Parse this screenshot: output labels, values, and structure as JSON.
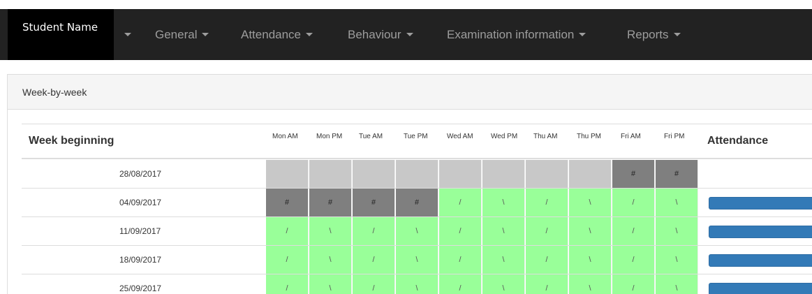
{
  "navbar": {
    "brand": "Student Name",
    "items": [
      {
        "label": ""
      },
      {
        "label": "General"
      },
      {
        "label": "Attendance"
      },
      {
        "label": "Behaviour"
      },
      {
        "label": "Examination information"
      },
      {
        "label": "Reports"
      }
    ]
  },
  "panel": {
    "title": "Week-by-week"
  },
  "table": {
    "header_week": "Week beginning",
    "header_attendance": "Attendance",
    "sessions": [
      "Mon AM",
      "Mon PM",
      "Tue AM",
      "Tue PM",
      "Wed AM",
      "Wed PM",
      "Thu AM",
      "Thu PM",
      "Fri AM",
      "Fri PM"
    ],
    "rows": [
      {
        "date": "28/08/2017",
        "marks": [
          "",
          "",
          "",
          "",
          "",
          "",
          "",
          "",
          "#",
          "#"
        ],
        "status": [
          "na",
          "na",
          "na",
          "na",
          "na",
          "na",
          "na",
          "na",
          "dk",
          "dk"
        ],
        "bar": false
      },
      {
        "date": "04/09/2017",
        "marks": [
          "#",
          "#",
          "#",
          "#",
          "/",
          "\\",
          "/",
          "\\",
          "/",
          "\\"
        ],
        "status": [
          "dk",
          "dk",
          "dk",
          "dk",
          "pr",
          "pr",
          "pr",
          "pr",
          "pr",
          "pr"
        ],
        "bar": true
      },
      {
        "date": "11/09/2017",
        "marks": [
          "/",
          "\\",
          "/",
          "\\",
          "/",
          "\\",
          "/",
          "\\",
          "/",
          "\\"
        ],
        "status": [
          "pr",
          "pr",
          "pr",
          "pr",
          "pr",
          "pr",
          "pr",
          "pr",
          "pr",
          "pr"
        ],
        "bar": true
      },
      {
        "date": "18/09/2017",
        "marks": [
          "/",
          "\\",
          "/",
          "\\",
          "/",
          "\\",
          "/",
          "\\",
          "/",
          "\\"
        ],
        "status": [
          "pr",
          "pr",
          "pr",
          "pr",
          "pr",
          "pr",
          "pr",
          "pr",
          "pr",
          "pr"
        ],
        "bar": true
      },
      {
        "date": "25/09/2017",
        "marks": [
          "/",
          "\\",
          "/",
          "\\",
          "/",
          "\\",
          "/",
          "\\",
          "/",
          "\\"
        ],
        "status": [
          "pr",
          "pr",
          "pr",
          "pr",
          "pr",
          "pr",
          "pr",
          "pr",
          "pr",
          "pr"
        ],
        "bar": true
      }
    ]
  },
  "colors": {
    "navbar_bg": "#222222",
    "present": "#99ff99",
    "unavailable": "#c8c8c8",
    "no_session": "#7f7f7f",
    "attendance_bar": "#337ab7"
  }
}
